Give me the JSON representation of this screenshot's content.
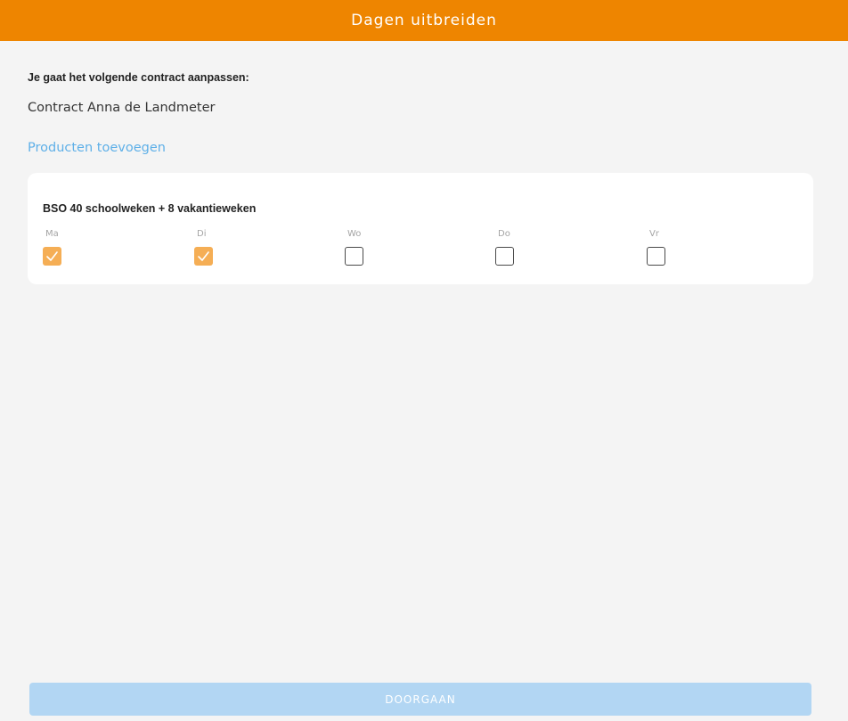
{
  "header": {
    "title": "Dagen uitbreiden"
  },
  "intro": {
    "label": "Je gaat het volgende contract aanpassen:",
    "contract_name": "Contract Anna de Landmeter"
  },
  "add_products_link": "Producten toevoegen",
  "product": {
    "name": "BSO 40 schoolweken + 8 vakantieweken",
    "days": [
      {
        "label": "Ma",
        "checked": true
      },
      {
        "label": "Di",
        "checked": true
      },
      {
        "label": "Wo",
        "checked": false
      },
      {
        "label": "Do",
        "checked": false
      },
      {
        "label": "Vr",
        "checked": false
      }
    ]
  },
  "submit_button": {
    "label": "DOORGAAN",
    "enabled": false
  },
  "colors": {
    "header": "#ee8500",
    "checkbox_checked": "#f5ae55",
    "link": "#5fb0e8",
    "button_disabled": "#b2d6f3",
    "background": "#f4f4f4"
  }
}
